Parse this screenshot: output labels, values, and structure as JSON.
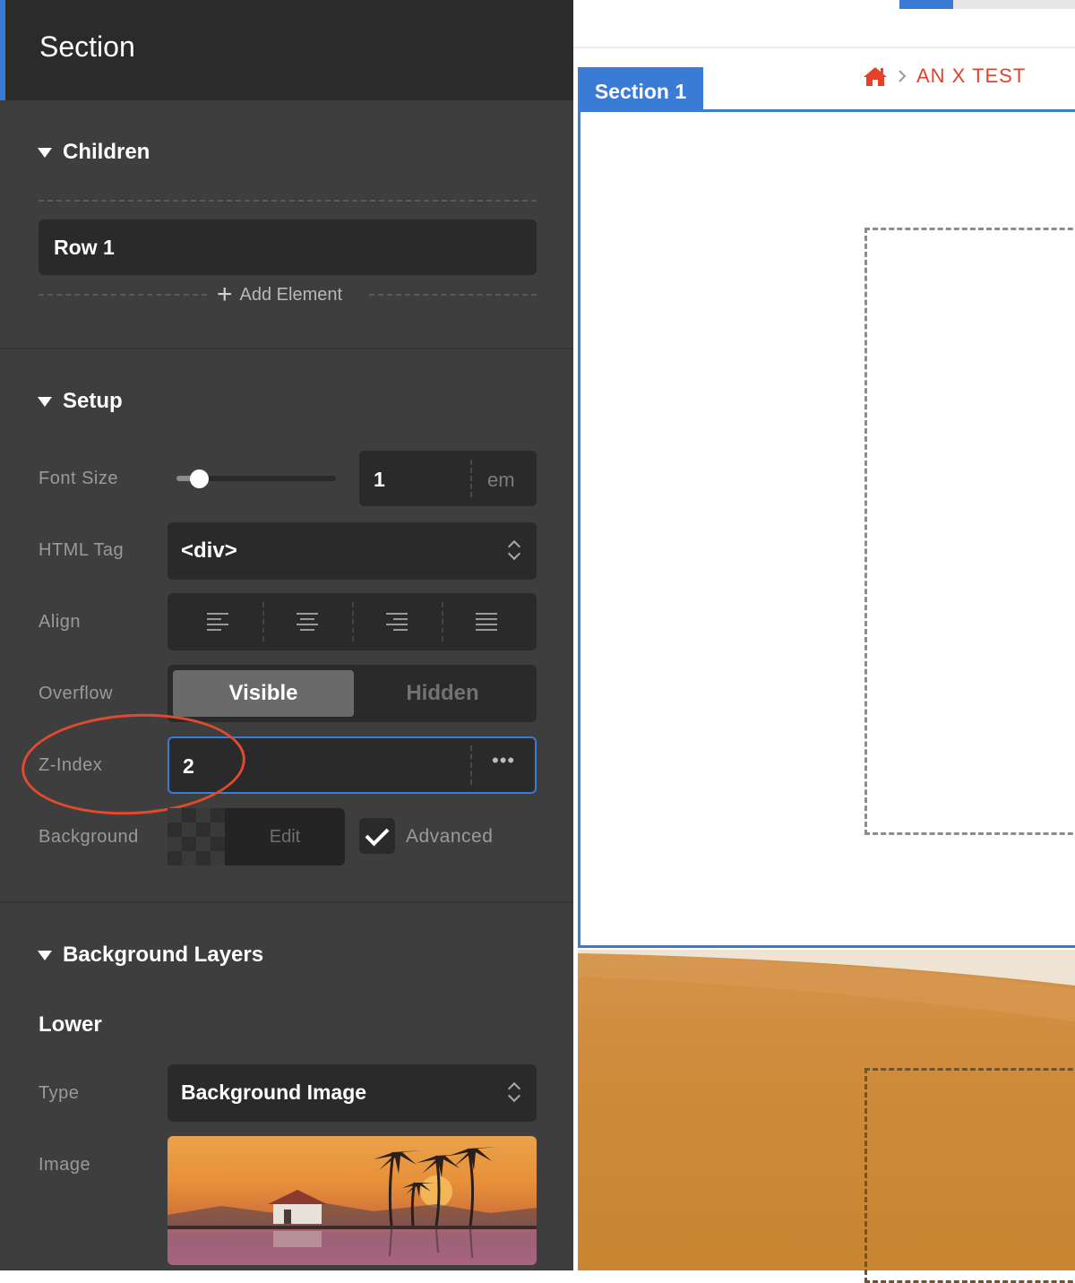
{
  "panel": {
    "title": "Section",
    "children": {
      "heading": "Children",
      "rows": [
        "Row 1"
      ],
      "add_label": "Add Element"
    },
    "setup": {
      "heading": "Setup",
      "font_size": {
        "label": "Font Size",
        "value": "1",
        "unit": "em",
        "slider_level": 0.15
      },
      "html_tag": {
        "label": "HTML Tag",
        "value": "<div>"
      },
      "align": {
        "label": "Align",
        "options": [
          "left-align-icon",
          "center-align-icon",
          "right-align-icon",
          "justify-align-icon"
        ]
      },
      "overflow": {
        "label": "Overflow",
        "options": [
          "Visible",
          "Hidden"
        ],
        "selected": "Visible"
      },
      "z_index": {
        "label": "Z-Index",
        "value": "2"
      },
      "background": {
        "label": "Background",
        "edit_label": "Edit",
        "advanced_label": "Advanced",
        "advanced_checked": true
      }
    },
    "background_layers": {
      "heading": "Background Layers",
      "lower": {
        "title": "Lower",
        "type_label": "Type",
        "type_value": "Background Image",
        "image_label": "Image"
      }
    }
  },
  "canvas": {
    "section_tag": "Section 1",
    "breadcrumb": "AN X TEST"
  },
  "colors": {
    "accent": "#3a7bd5",
    "annotation": "#e04a2f",
    "breadcrumb": "#e6402b",
    "panel_bg": "#3e3e3e"
  }
}
